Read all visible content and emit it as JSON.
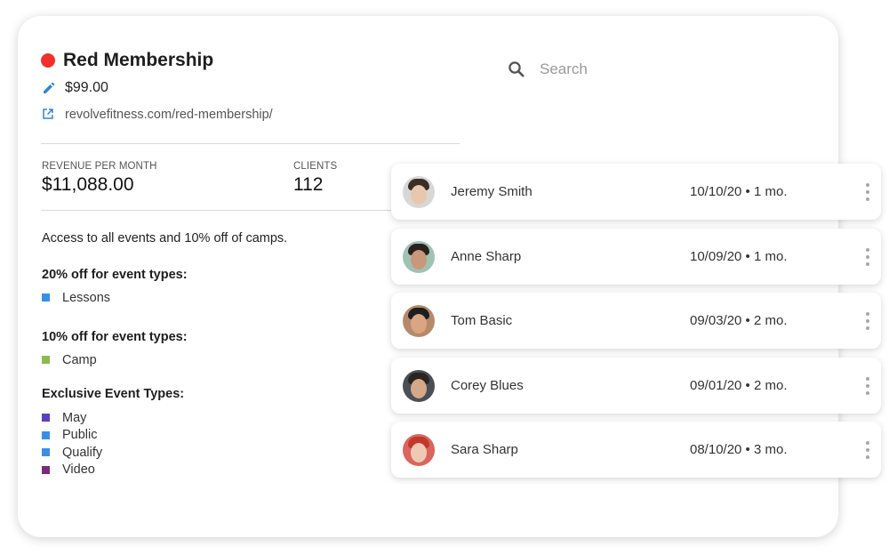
{
  "membership": {
    "name": "Red Membership",
    "color": "#f0302a",
    "price": "$99.00",
    "url": "revolvefitness.com/red-membership/",
    "icons": {
      "price": "pencil-icon",
      "url": "external-link-icon"
    }
  },
  "stats": {
    "revenue_label": "REVENUE PER MONTH",
    "revenue_value": "$11,088.00",
    "clients_label": "CLIENTS",
    "clients_value": "112"
  },
  "description": "Access to all events and 10% off of camps.",
  "groups": [
    {
      "heading": "20% off for event types:",
      "items": [
        {
          "label": "Lessons",
          "color": "#3a8ee6"
        }
      ]
    },
    {
      "heading": "10% off for event types:",
      "items": [
        {
          "label": "Camp",
          "color": "#8bbb4c"
        }
      ]
    },
    {
      "heading": "Exclusive Event Types:",
      "items": [
        {
          "label": "May",
          "color": "#5a3fbf"
        },
        {
          "label": "Public",
          "color": "#3a8ee6"
        },
        {
          "label": "Qualify",
          "color": "#3a8ee6"
        },
        {
          "label": "Video",
          "color": "#7b2a7e"
        }
      ]
    }
  ],
  "search": {
    "placeholder": "Search",
    "icon": "search-icon"
  },
  "clients": [
    {
      "name": "Jeremy Smith",
      "date": "10/10/20 • 1 mo.",
      "avatar": {
        "bg": "#d7d7d7",
        "skin": "#e8c7ad",
        "hair": "#3a2d24"
      }
    },
    {
      "name": "Anne Sharp",
      "date": "10/09/20 • 1 mo.",
      "avatar": {
        "bg": "#9ec3b4",
        "skin": "#c9977a",
        "hair": "#2a211c"
      }
    },
    {
      "name": "Tom Basic",
      "date": "09/03/20 • 2 mo.",
      "avatar": {
        "bg": "#b58a6a",
        "skin": "#d9a582",
        "hair": "#1e1e1e"
      }
    },
    {
      "name": "Corey Blues",
      "date": "09/01/20 • 2 mo.",
      "avatar": {
        "bg": "#4a4f55",
        "skin": "#d5a88a",
        "hair": "#2b2420"
      }
    },
    {
      "name": "Sara Sharp",
      "date": "08/10/20 • 3 mo.",
      "avatar": {
        "bg": "#d9665e",
        "skin": "#efc9b3",
        "hair": "#c0392b"
      }
    }
  ]
}
